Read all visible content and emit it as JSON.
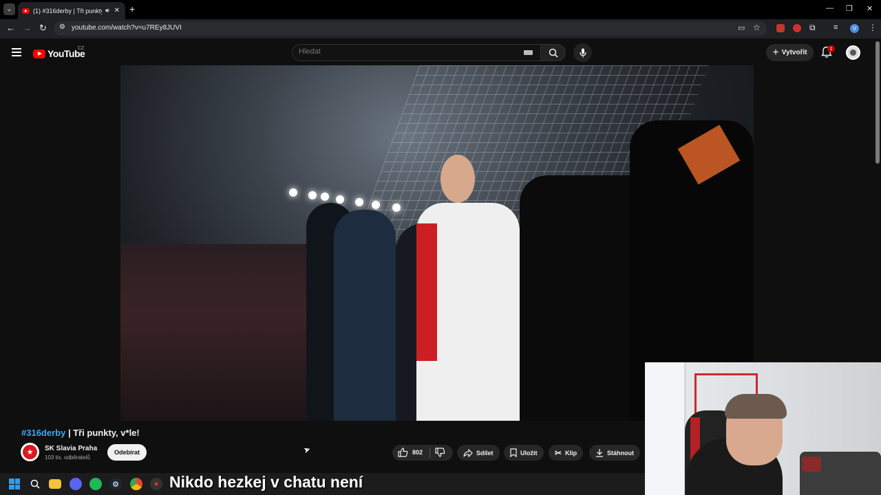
{
  "browser": {
    "tab_title": "(1) #316derby | Tři punkty, v",
    "url": "youtube.com/watch?v=u7REy8JUVI"
  },
  "youtube": {
    "logo_text": "YouTube",
    "region": "CZ",
    "search_placeholder": "Hledat",
    "create_label": "Vytvořit",
    "notification_count": "1"
  },
  "video": {
    "hashtag": "#316derby",
    "title_rest": " | Tři punkty, v*le!",
    "channel_name": "SK Slavia Praha",
    "subscribers": "103 tis. odběratelů",
    "subscribe_label": "Odebírat",
    "like_count": "802",
    "share_label": "Sdílet",
    "save_label": "Uložit",
    "clip_label": "Klip",
    "download_label": "Stáhnout"
  },
  "overlay": {
    "caption": "Nikdo hezkej v chatu není"
  },
  "colors": {
    "youtube_red": "#ff0000",
    "hashtag_blue": "#3ea6ff",
    "background": "#0f0f0f"
  }
}
